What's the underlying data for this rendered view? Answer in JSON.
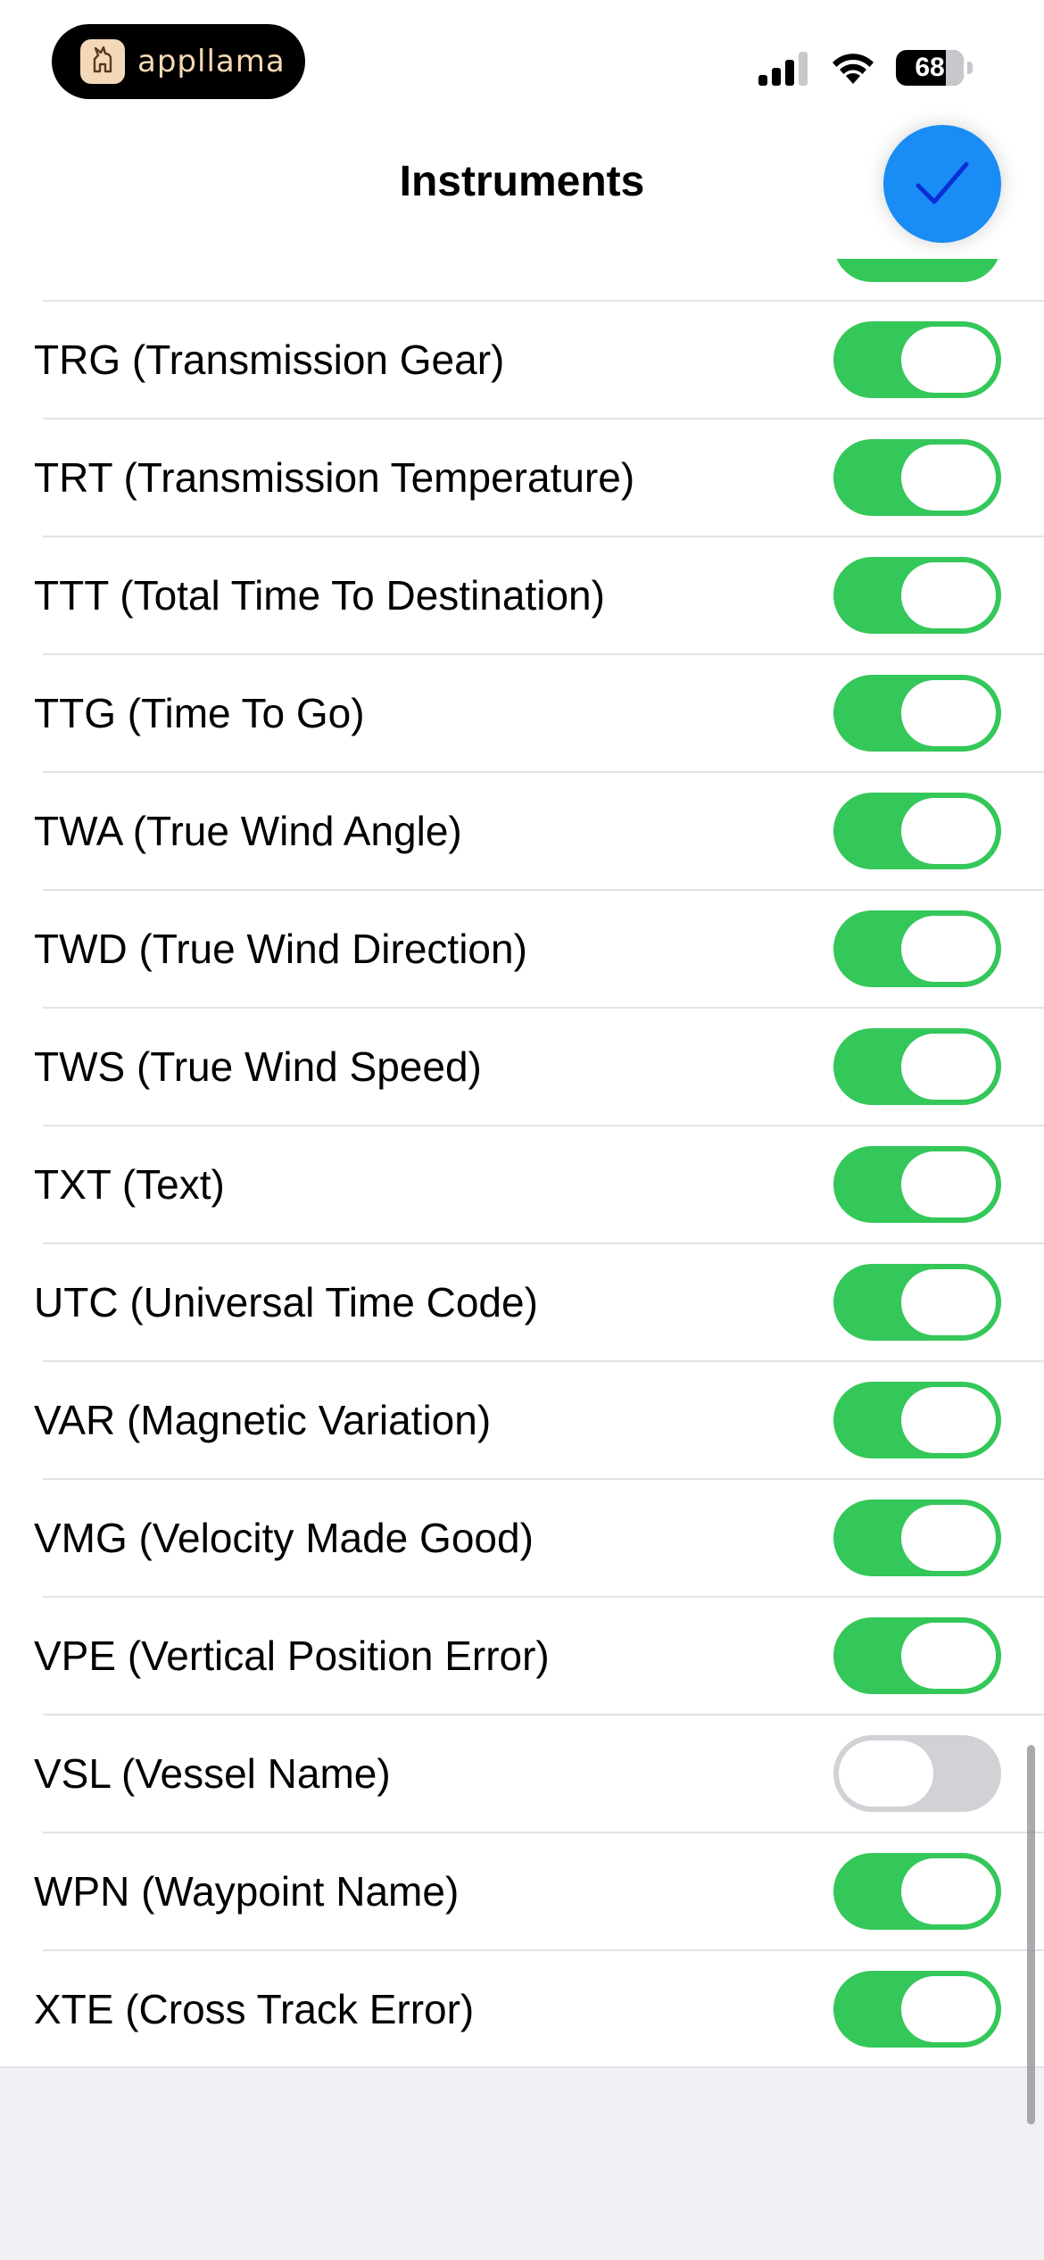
{
  "status_bar": {
    "app_badge_text": "appllama",
    "battery_level": "68",
    "icons": [
      "cellular-signal-icon",
      "wifi-icon",
      "battery-icon"
    ]
  },
  "header": {
    "title": "Instruments",
    "confirm_icon": "checkmark-icon"
  },
  "colors": {
    "toggle_on": "#34c759",
    "toggle_off": "#d1d1d6",
    "accent": "#1a8cf5"
  },
  "instruments": [
    {
      "label": "TRG (Transmission Gear)",
      "enabled": true
    },
    {
      "label": "TRT (Transmission Temperature)",
      "enabled": true
    },
    {
      "label": "TTT (Total Time To Destination)",
      "enabled": true
    },
    {
      "label": "TTG (Time To Go)",
      "enabled": true
    },
    {
      "label": "TWA (True Wind Angle)",
      "enabled": true
    },
    {
      "label": "TWD (True Wind Direction)",
      "enabled": true
    },
    {
      "label": "TWS (True Wind Speed)",
      "enabled": true
    },
    {
      "label": "TXT (Text)",
      "enabled": true
    },
    {
      "label": "UTC (Universal Time Code)",
      "enabled": true
    },
    {
      "label": "VAR (Magnetic Variation)",
      "enabled": true
    },
    {
      "label": "VMG (Velocity Made Good)",
      "enabled": true
    },
    {
      "label": "VPE (Vertical Position Error)",
      "enabled": true
    },
    {
      "label": "VSL (Vessel Name)",
      "enabled": false
    },
    {
      "label": "WPN (Waypoint Name)",
      "enabled": true
    },
    {
      "label": "XTE (Cross Track Error)",
      "enabled": true
    }
  ]
}
